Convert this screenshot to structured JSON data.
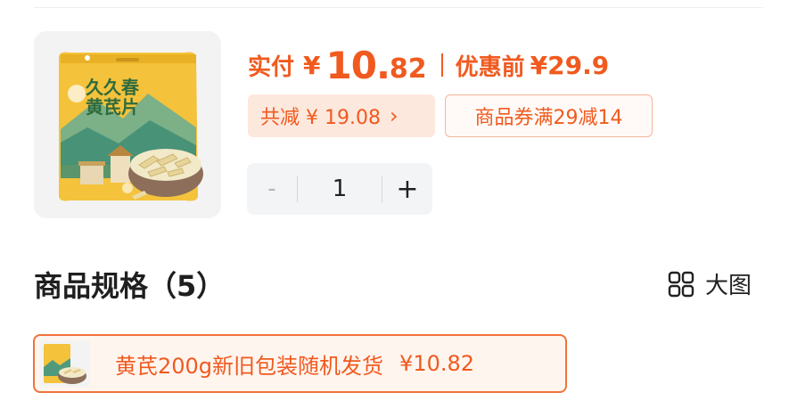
{
  "product": {
    "image_icon": "product-package-image",
    "package_title_line1": "久久春",
    "package_title_line2": "黄芪片"
  },
  "price": {
    "paid_label": "实付",
    "currency": "¥",
    "paid_int": "10.",
    "paid_dec": "82",
    "original_label": "优惠前",
    "original_price": "¥29.9"
  },
  "discount": {
    "total_text": "共减 ¥ 19.08",
    "chevron": "›",
    "coupon_text": "商品券满29减14"
  },
  "quantity": {
    "minus": "-",
    "value": "1",
    "plus": "+"
  },
  "spec": {
    "title": "商品规格（5）",
    "big_view_label": "大图",
    "options": [
      {
        "name": "黄芪200g新旧包装随机发货",
        "price": "¥10.82",
        "selected": true
      }
    ]
  },
  "colors": {
    "accent": "#f05a1f",
    "chip_bg": "#fde8dd",
    "stepper_bg": "#f3f4f6"
  }
}
